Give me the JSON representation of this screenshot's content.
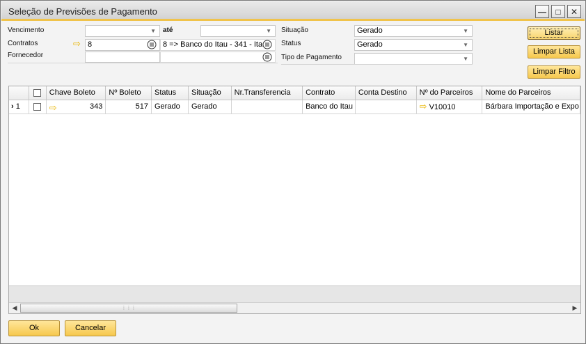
{
  "window": {
    "title": "Seleção de Previsões de Pagamento",
    "controls": {
      "minimize": "—",
      "maximize": "□",
      "close": "✕"
    }
  },
  "filters": {
    "vencimento_label": "Vencimento",
    "vencimento_value": "",
    "ate_label": "até",
    "ate_value": "",
    "contratos_label": "Contratos",
    "contratos_value": "8",
    "contratos_desc": "8 => Banco do Itau - 341 - Ita",
    "fornecedor_label": "Fornecedor",
    "fornecedor_value": "",
    "fornecedor_desc": "",
    "situacao_label": "Situação",
    "situacao_value": "Gerado",
    "status_label": "Status",
    "status_value": "Gerado",
    "tipo_pagamento_label": "Tipo de Pagamento",
    "tipo_pagamento_value": ""
  },
  "actions": {
    "listar": "Listar",
    "limpar_lista": "Limpar Lista",
    "limpar_filtro": "Limpar Filtro"
  },
  "grid": {
    "columns": [
      "Chave Boleto",
      "Nº Boleto",
      "Status",
      "Situação",
      "Nr.Transferencia",
      "Contrato",
      "Conta Destino",
      "Nº do Parceiros",
      "Nome do Parceiros"
    ],
    "rows": [
      {
        "row_number": "1",
        "chave_boleto": "343",
        "numero_boleto": "517",
        "status": "Gerado",
        "situacao": "Gerado",
        "nr_transferencia": "",
        "contrato": "Banco do Itau",
        "conta_destino": "",
        "numero_parceiro": "V10010",
        "nome_parceiro": "Bárbara Importação e Expo"
      }
    ]
  },
  "footer": {
    "ok": "Ok",
    "cancelar": "Cancelar"
  },
  "colors": {
    "title_accent": "#f0c34b",
    "button_yellow": "#f6c84d",
    "link_arrow": "#e8b500"
  },
  "icons": {
    "link_arrow": "arrow-right-icon",
    "list_button": "list-icon",
    "dropdown": "chevron-down-icon",
    "row_marker": "row-pointer-icon"
  }
}
